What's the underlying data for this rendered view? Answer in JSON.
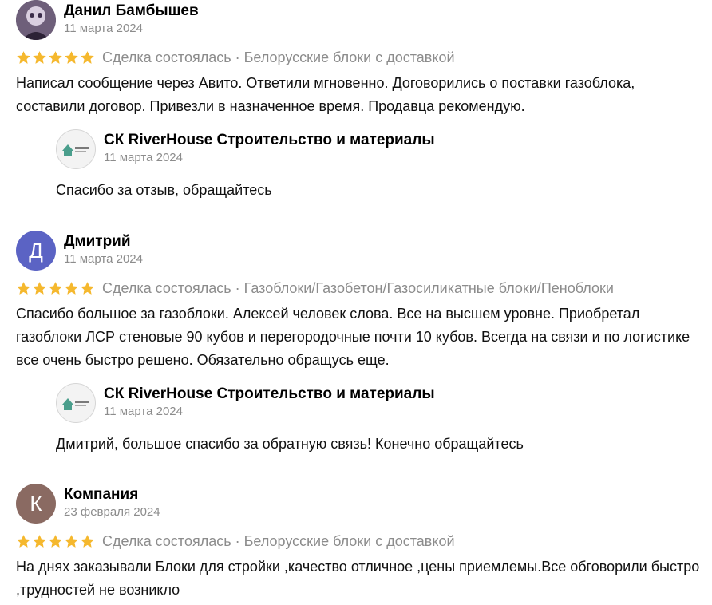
{
  "colors": {
    "star": "#f5b82e",
    "muted_text": "#8c8c8c",
    "avatar_d": "#5b63c4",
    "avatar_k": "#8a6a62"
  },
  "reviews": [
    {
      "author": "Данил Бамбышев",
      "date": "11 марта 2024",
      "avatar_letter": "",
      "rating": 5,
      "deal_info": "Сделка состоялась · Белорусские блоки с доставкой",
      "text": "Написал сообщение через Авито. Ответили мгновенно. Договорились о поставки газоблока, составили договор. Привезли в назначенное время. Продавца рекомендую.",
      "reply": {
        "author": "СК RiverHouse Строительство и материалы",
        "date": "11 марта 2024",
        "text": "Спасибо за отзыв, обращайтесь"
      }
    },
    {
      "author": "Дмитрий",
      "date": "11 марта 2024",
      "avatar_letter": "Д",
      "rating": 5,
      "deal_info": "Сделка состоялась · Газоблоки/Газобетон/Газосиликатные блоки/Пеноблоки",
      "text": "Спасибо большое за газоблоки. Алексей человек слова. Все на высшем уровне. Приобретал газоблоки ЛСР стеновые 90 кубов и перегородочные почти 10 кубов. Всегда на связи и по логистике все очень быстро решено. Обязательно обращусь еще.",
      "reply": {
        "author": "СК RiverHouse Строительство и материалы",
        "date": "11 марта 2024",
        "text": "Дмитрий, большое спасибо за обратную связь! Конечно обращайтесь"
      }
    },
    {
      "author": "Компания",
      "date": "23 февраля 2024",
      "avatar_letter": "К",
      "rating": 5,
      "deal_info": "Сделка состоялась · Белорусские блоки с доставкой",
      "text": "На днях заказывали Блоки для стройки ,качество отличное ,цены приемлемы.Все обговорили быстро ,трудностей не возникло"
    }
  ]
}
